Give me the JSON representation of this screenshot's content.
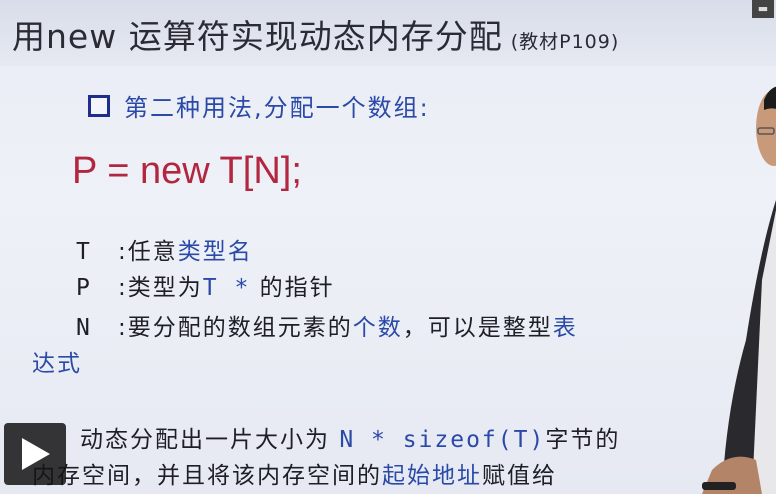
{
  "slide": {
    "title": "用new 运算符实现动态内存分配",
    "title_ref": "(教材P109)",
    "bullet": "第二种用法,分配一个数组:",
    "formula": "P = new T[N];",
    "defs": [
      {
        "key": "T",
        "sep": ":",
        "text": "任意",
        "blue": "类型名",
        "rest": ""
      },
      {
        "key": "P",
        "sep": ":",
        "text": "类型为",
        "blue": "T *",
        "rest": " 的指针"
      },
      {
        "key": "N",
        "sep": ":",
        "text": "要分配的数组元素的",
        "blue": "个数",
        "rest": "，可以是整型"
      }
    ],
    "defs_tail_blue": "表",
    "defs_wrap_blue": "达式",
    "para1_a": "动态分配出一片大小为 ",
    "para1_mono": "N * sizeof(T)",
    "para1_b": "字节的",
    "para2_a": "内存空间，并且将该内存空间的",
    "para2_blue": "起始地址",
    "para2_b": "赋值给"
  },
  "player": {
    "play_icon": "play-icon",
    "corner_icons": [
      "minimize-icon",
      "close-icon"
    ]
  },
  "colors": {
    "title": "#2b2b36",
    "formula": "#b2263f",
    "accent_blue": "#2b4aa8",
    "text": "#1e1e26"
  }
}
